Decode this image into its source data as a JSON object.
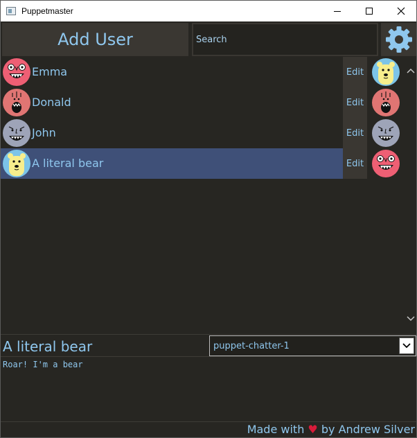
{
  "window": {
    "title": "Puppetmaster"
  },
  "header": {
    "add_user_label": "Add User",
    "search_placeholder": "Search",
    "settings_icon": "gear-icon"
  },
  "users": [
    {
      "name": "Emma",
      "edit_label": "Edit",
      "avatar": "pink-monster-face",
      "puppet": "yellow-bear-face",
      "selected": false
    },
    {
      "name": "Donald",
      "edit_label": "Edit",
      "avatar": "salmon-monster-face",
      "puppet": "salmon-monster-face",
      "selected": false
    },
    {
      "name": "John",
      "edit_label": "Edit",
      "avatar": "grey-monster-face",
      "puppet": "grey-monster-face",
      "selected": false
    },
    {
      "name": "A literal bear",
      "edit_label": "Edit",
      "avatar": "yellow-bear-face",
      "puppet": "pink-monster-face",
      "selected": true
    }
  ],
  "detail": {
    "selected_name": "A literal bear",
    "puppet_select_value": "puppet-chatter-1",
    "message": "Roar! I'm a bear"
  },
  "footer": {
    "prefix": "Made with",
    "heart": "♥",
    "suffix": "by Andrew Silver"
  },
  "colors": {
    "background": "#272622",
    "button": "#3a3732",
    "accent_text": "#8fc7ee",
    "selected_row": "#3f5078",
    "heart": "#d81b3a",
    "gear": "#8fc7ee"
  }
}
